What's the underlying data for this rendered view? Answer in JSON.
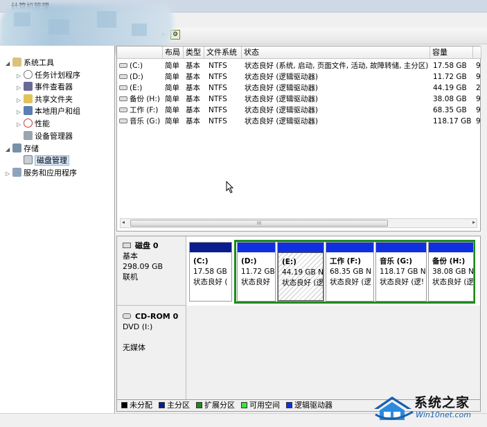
{
  "window": {
    "title": "计算机管理"
  },
  "tree": {
    "items": [
      {
        "label": "系统工具",
        "icon": "tools-icon",
        "indent": 0,
        "arrow": "◢"
      },
      {
        "label": "任务计划程序",
        "icon": "clock-icon",
        "indent": 1,
        "arrow": "▷"
      },
      {
        "label": "事件查看器",
        "icon": "event-viewer-icon",
        "indent": 1,
        "arrow": "▷"
      },
      {
        "label": "共享文件夹",
        "icon": "shared-folder-icon",
        "indent": 1,
        "arrow": "▷"
      },
      {
        "label": "本地用户和组",
        "icon": "users-icon",
        "indent": 1,
        "arrow": "▷"
      },
      {
        "label": "性能",
        "icon": "performance-icon",
        "indent": 1,
        "arrow": "▷"
      },
      {
        "label": "设备管理器",
        "icon": "device-manager-icon",
        "indent": 1,
        "arrow": ""
      },
      {
        "label": "存储",
        "icon": "storage-icon",
        "indent": 0,
        "arrow": "◢"
      },
      {
        "label": "磁盘管理",
        "icon": "disk-management-icon",
        "indent": 1,
        "arrow": "",
        "selected": true
      },
      {
        "label": "服务和应用程序",
        "icon": "services-icon",
        "indent": 0,
        "arrow": "▷"
      }
    ]
  },
  "volume_list": {
    "columns": [
      "布局",
      "类型",
      "文件系统",
      "状态",
      "容量"
    ],
    "rows": [
      {
        "volume": "(C:)",
        "layout": "简单",
        "type": "基本",
        "fs": "NTFS",
        "status": "状态良好 (系统, 启动, 页面文件, 活动, 故障转储, 主分区)",
        "capacity": "17.58 GB",
        "extra": "9"
      },
      {
        "volume": "(D:)",
        "layout": "简单",
        "type": "基本",
        "fs": "NTFS",
        "status": "状态良好 (逻辑驱动器)",
        "capacity": "11.72 GB",
        "extra": "9"
      },
      {
        "volume": "(E:)",
        "layout": "简单",
        "type": "基本",
        "fs": "NTFS",
        "status": "状态良好 (逻辑驱动器)",
        "capacity": "44.19 GB",
        "extra": "2"
      },
      {
        "volume": "备份 (H:)",
        "layout": "简单",
        "type": "基本",
        "fs": "NTFS",
        "status": "状态良好 (逻辑驱动器)",
        "capacity": "38.08 GB",
        "extra": "9"
      },
      {
        "volume": "工作 (F:)",
        "layout": "简单",
        "type": "基本",
        "fs": "NTFS",
        "status": "状态良好 (逻辑驱动器)",
        "capacity": "68.35 GB",
        "extra": "9"
      },
      {
        "volume": "音乐 (G:)",
        "layout": "简单",
        "type": "基本",
        "fs": "NTFS",
        "status": "状态良好 (逻辑驱动器)",
        "capacity": "118.17 GB",
        "extra": "9"
      }
    ],
    "scroll_grip": "III"
  },
  "disks": {
    "disk0": {
      "name": "磁盘 0",
      "type": "基本",
      "size": "298.09 GB",
      "state": "联机",
      "partitions": [
        {
          "name": "(C:)",
          "size": "17.58 GB",
          "status": "状态良好 (",
          "bar_color": "#0a1d8c"
        },
        {
          "name": "(D:)",
          "size": "11.72 GB",
          "status": "状态良好",
          "bar_color": "#1030e0"
        },
        {
          "name": "(E:)",
          "size": "44.19 GB N",
          "status": "状态良好 (逻",
          "bar_color": "#1030e0",
          "selected": true
        },
        {
          "name": "工作 (F:)",
          "size": "68.35 GB N",
          "status": "状态良好 (逻",
          "bar_color": "#1030e0"
        },
        {
          "name": "音乐 (G:)",
          "size": "118.17 GB N",
          "status": "状态良好 (逻!",
          "bar_color": "#1030e0"
        },
        {
          "name": "备份 (H:)",
          "size": "38.08 GB N",
          "status": "状态良好 (逻",
          "bar_color": "#1030e0"
        }
      ]
    },
    "cdrom0": {
      "name": "CD-ROM 0",
      "type": "DVD (I:)",
      "media": "无媒体"
    }
  },
  "legend": [
    {
      "label": "未分配",
      "color": "#000000"
    },
    {
      "label": "主分区",
      "color": "#0a1d8c"
    },
    {
      "label": "扩展分区",
      "color": "#1e8a1e"
    },
    {
      "label": "可用空间",
      "color": "#3fe03f"
    },
    {
      "label": "逻辑驱动器",
      "color": "#1030e0"
    }
  ],
  "watermark": {
    "title": "系统之家",
    "url": "Win10net.com"
  }
}
